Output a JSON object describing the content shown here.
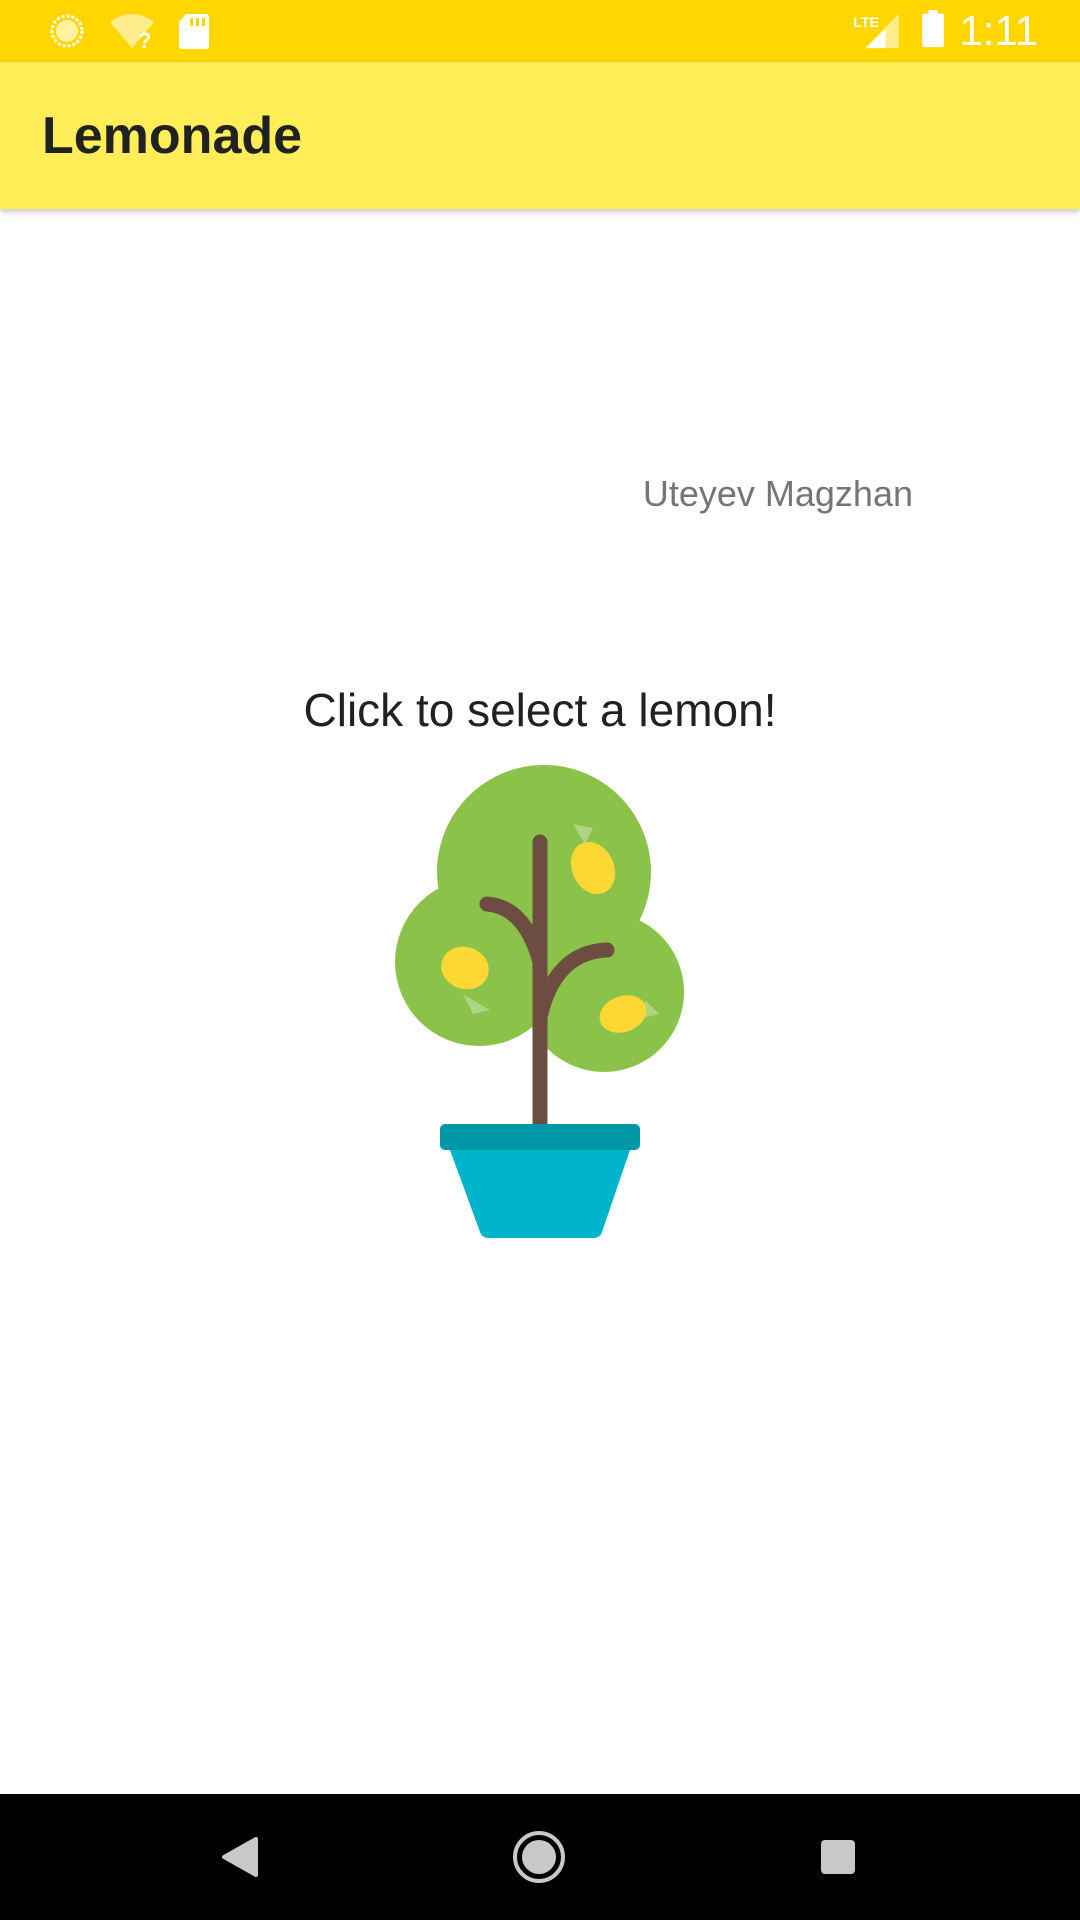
{
  "status_bar": {
    "time": "1:11",
    "icons": [
      "notification-circle-icon",
      "wifi-unknown-icon",
      "sd-card-icon",
      "lte-signal-icon",
      "battery-icon"
    ],
    "background_color": "#FFD600"
  },
  "app_bar": {
    "title": "Lemonade",
    "background_color": "#FFEE58"
  },
  "content": {
    "author": "Uteyev Magzhan",
    "instruction": "Click to select a lemon!",
    "image": "lemon-tree-icon"
  },
  "nav_bar": {
    "buttons": [
      "back-icon",
      "home-icon",
      "recents-icon"
    ]
  }
}
